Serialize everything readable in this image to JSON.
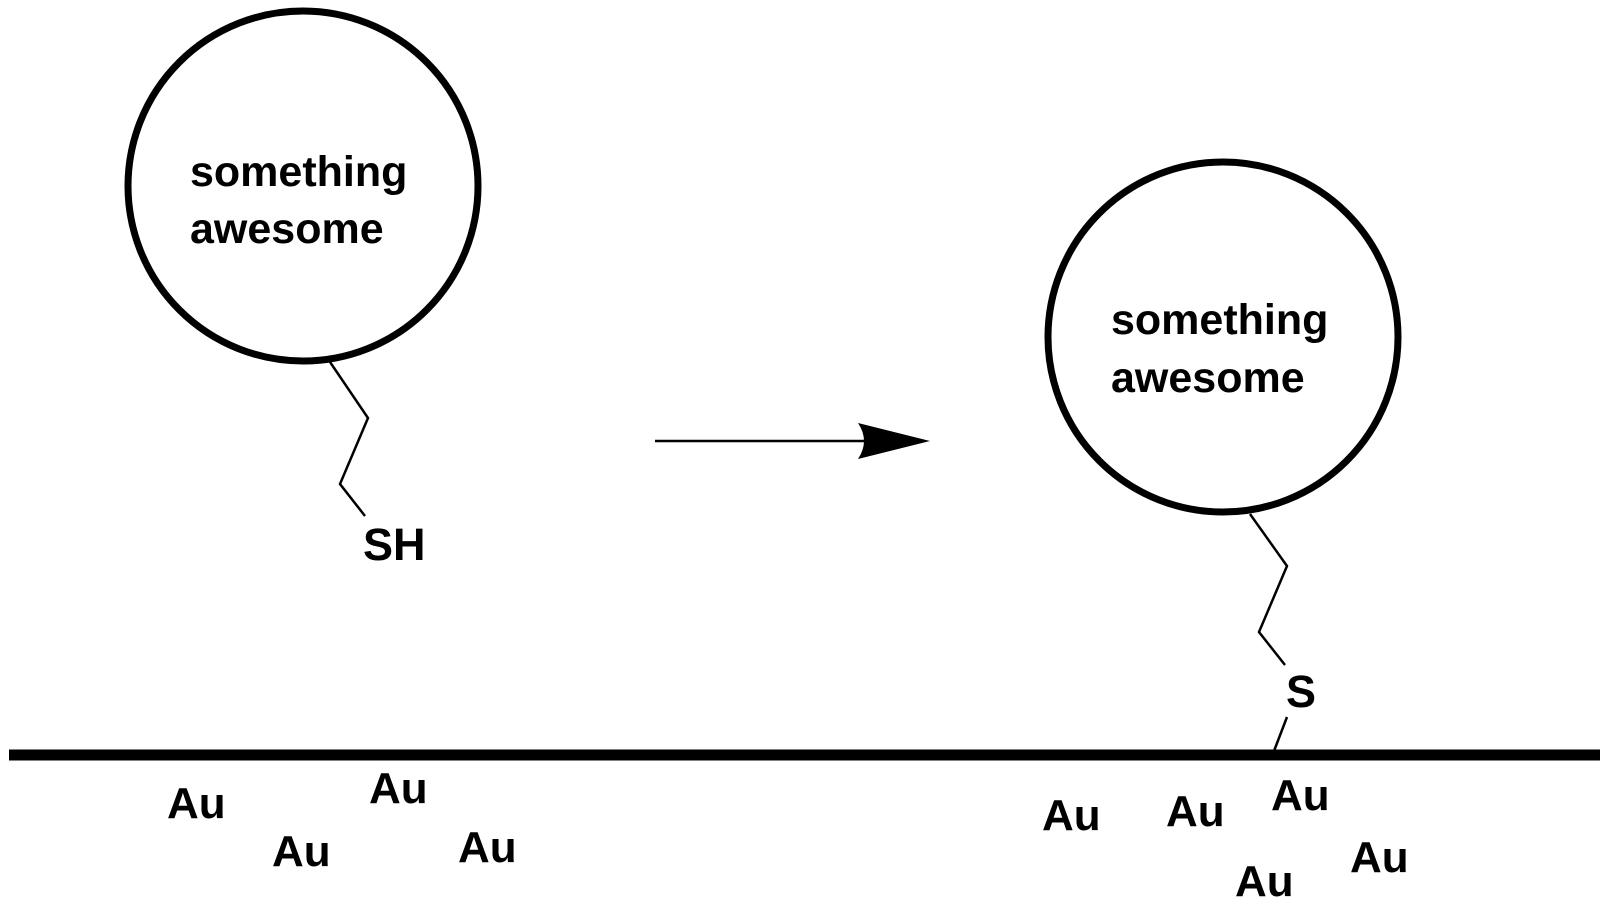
{
  "reactant": {
    "line1": "something",
    "line2": "awesome",
    "thiol_group": "SH"
  },
  "product": {
    "line1": "something",
    "line2": "awesome",
    "sulfur": "S"
  },
  "gold": {
    "left": [
      "Au",
      "Au",
      "Au",
      "Au"
    ],
    "right": [
      "Au",
      "Au",
      "Au",
      "Au",
      "Au"
    ]
  },
  "colors": {
    "ink": "#000000",
    "background": "#ffffff"
  }
}
